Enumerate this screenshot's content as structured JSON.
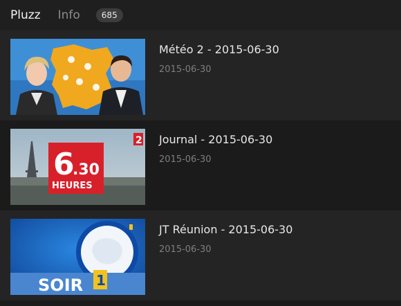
{
  "header": {
    "tabs": [
      {
        "label": "Pluzz",
        "active": true
      },
      {
        "label": "Info",
        "active": false
      }
    ],
    "count": "685"
  },
  "items": [
    {
      "title": "Météo 2 - 2015-06-30",
      "date": "2015-06-30",
      "thumbnail": "weather-forecast-presenters"
    },
    {
      "title": "Journal - 2015-06-30",
      "date": "2015-06-30",
      "thumbnail": "news-630-heures-paris"
    },
    {
      "title": "JT Réunion - 2015-06-30",
      "date": "2015-06-30",
      "thumbnail": "soir-1-reunion-logo"
    }
  ],
  "thumb_text": {
    "big_num": "6",
    "small_num": ".30",
    "heures": "HEURES",
    "channel": "2",
    "soir": "SOIR",
    "one": "1"
  },
  "colors": {
    "background": "#1b1b1b",
    "header": "#1f1f1f",
    "row_alt": "#242424",
    "badge": "#3c3c3c",
    "france2_red": "#d8202a",
    "reunion_blue": "#1560b8"
  }
}
